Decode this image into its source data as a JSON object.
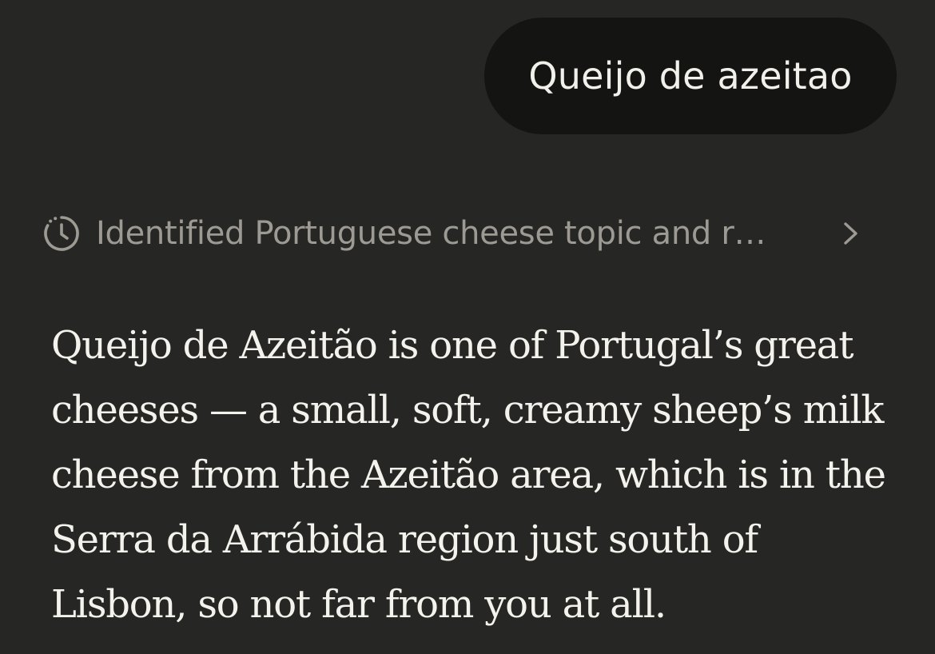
{
  "user_message": {
    "text": "Queijo de azeitao"
  },
  "thinking": {
    "icon": "clock-icon",
    "summary": "Identified Portuguese cheese topic and r…",
    "expand_icon": "chevron-right-icon"
  },
  "assistant_message": {
    "text": "Queijo de Azeitão is one of Portugal’s great cheeses — a small, soft, creamy sheep’s milk cheese from the Azeitão area, which is in the Serra da Arrábida region just south of Lisbon, so not far from you at all."
  },
  "colors": {
    "background": "#262624",
    "user_bubble": "#141413",
    "text_primary": "#f4f2ec",
    "text_muted": "#9c9a93"
  }
}
